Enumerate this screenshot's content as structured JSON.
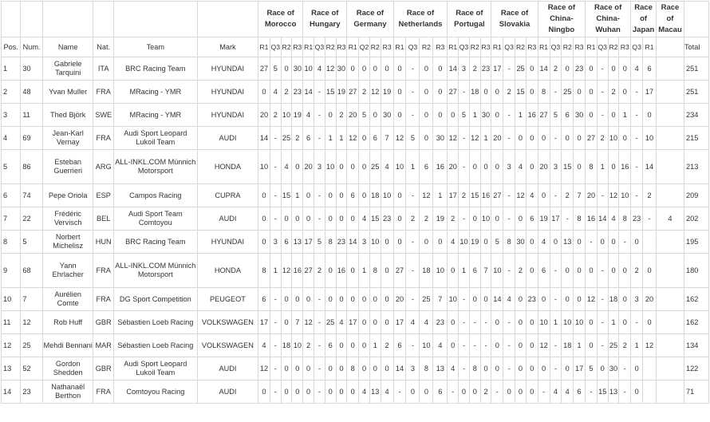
{
  "header": {
    "races": [
      {
        "label": "Race of Morocco",
        "rounds": [
          "R1",
          "Q3",
          "R2",
          "R3"
        ]
      },
      {
        "label": "Race of Hungary",
        "rounds": [
          "R1",
          "Q3",
          "R2",
          "R3"
        ]
      },
      {
        "label": "Race of Germany",
        "rounds": [
          "R1",
          "Q2",
          "R2",
          "R3"
        ]
      },
      {
        "label": "Race of Netherlands",
        "rounds": [
          "R1",
          "Q3",
          "R2",
          "R3"
        ]
      },
      {
        "label": "Race of Portugal",
        "rounds": [
          "R1",
          "Q3",
          "R2",
          "R3"
        ]
      },
      {
        "label": "Race of Slovakia",
        "rounds": [
          "R1",
          "Q3",
          "R2",
          "R3"
        ]
      },
      {
        "label": "Race of China-Ningbo",
        "rounds": [
          "R1",
          "Q3",
          "R2",
          "R3"
        ]
      },
      {
        "label": "Race of China-Wuhan",
        "rounds": [
          "R1",
          "Q3",
          "R2",
          "R3"
        ]
      },
      {
        "label": "Race of Japan",
        "rounds": [
          "Q3",
          "R1"
        ]
      },
      {
        "label": "Race of Macau",
        "rounds": [
          ""
        ]
      }
    ],
    "pos": "Pos.",
    "num": "Num.",
    "name": "Name",
    "nat": "Nat.",
    "team": "Team",
    "mark": "Mark",
    "total": "Total"
  },
  "rows": [
    {
      "pos": "1",
      "num": "30",
      "name": "Gabriele Tarquini",
      "nat": "ITA",
      "team": "BRC Racing Team",
      "mark": "HYUNDAI",
      "total": "251",
      "tall": false,
      "r": [
        "27",
        "5",
        "0",
        "30",
        "10",
        "4",
        "12",
        "30",
        "0",
        "0",
        "0",
        "0",
        "0",
        "-",
        "0",
        "0",
        "14",
        "3",
        "2",
        "23",
        "17",
        "-",
        "25",
        "0",
        "14",
        "2",
        "0",
        "23",
        "0",
        "-",
        "0",
        "0",
        "4",
        "6",
        ""
      ]
    },
    {
      "pos": "2",
      "num": "48",
      "name": "Yvan Muller",
      "nat": "FRA",
      "team": "MRacing - YMR",
      "mark": "HYUNDAI",
      "total": "251",
      "tall": false,
      "r": [
        "0",
        "4",
        "2",
        "23",
        "14",
        "-",
        "15",
        "19",
        "27",
        "2",
        "12",
        "19",
        "0",
        "-",
        "0",
        "0",
        "27",
        "-",
        "18",
        "0",
        "0",
        "2",
        "15",
        "0",
        "8",
        "-",
        "25",
        "0",
        "0",
        "-",
        "2",
        "0",
        "-",
        "17",
        ""
      ]
    },
    {
      "pos": "3",
      "num": "11",
      "name": "Thed Björk",
      "nat": "SWE",
      "team": "MRacing - YMR",
      "mark": "HYUNDAI",
      "total": "234",
      "tall": false,
      "r": [
        "20",
        "2",
        "10",
        "19",
        "4",
        "-",
        "0",
        "2",
        "20",
        "5",
        "0",
        "30",
        "0",
        "-",
        "0",
        "0",
        "0",
        "5",
        "1",
        "30",
        "0",
        "-",
        "1",
        "16",
        "27",
        "5",
        "6",
        "30",
        "0",
        "-",
        "0",
        "1",
        "-",
        "0",
        ""
      ]
    },
    {
      "pos": "4",
      "num": "69",
      "name": "Jean-Karl Vernay",
      "nat": "FRA",
      "team": "Audi Sport Leopard Lukoil Team",
      "mark": "AUDI",
      "total": "215",
      "tall": false,
      "r": [
        "14",
        "-",
        "25",
        "2",
        "6",
        "-",
        "1",
        "1",
        "12",
        "0",
        "6",
        "7",
        "12",
        "5",
        "0",
        "30",
        "12",
        "-",
        "12",
        "1",
        "20",
        "-",
        "0",
        "0",
        "0",
        "-",
        "0",
        "0",
        "27",
        "2",
        "10",
        "0",
        "-",
        "10",
        ""
      ]
    },
    {
      "pos": "5",
      "num": "86",
      "name": "Esteban Guerrieri",
      "nat": "ARG",
      "team": "ALL-INKL.COM Münnich Motorsport",
      "mark": "HONDA",
      "total": "213",
      "tall": true,
      "r": [
        "10",
        "-",
        "4",
        "0",
        "20",
        "3",
        "10",
        "0",
        "0",
        "0",
        "25",
        "4",
        "10",
        "1",
        "6",
        "16",
        "20",
        "-",
        "0",
        "0",
        "0",
        "3",
        "4",
        "0",
        "20",
        "3",
        "15",
        "0",
        "8",
        "1",
        "0",
        "16",
        "-",
        "14",
        ""
      ]
    },
    {
      "pos": "6",
      "num": "74",
      "name": "Pepe Oriola",
      "nat": "ESP",
      "team": "Campos Racing",
      "mark": "CUPRA",
      "total": "209",
      "tall": false,
      "r": [
        "0",
        "-",
        "15",
        "1",
        "0",
        "-",
        "0",
        "0",
        "6",
        "0",
        "18",
        "10",
        "0",
        "-",
        "12",
        "1",
        "17",
        "2",
        "15",
        "16",
        "27",
        "-",
        "12",
        "4",
        "0",
        "-",
        "2",
        "7",
        "20",
        "-",
        "12",
        "10",
        "-",
        "2",
        ""
      ]
    },
    {
      "pos": "7",
      "num": "22",
      "name": "Frédéric Vervisch",
      "nat": "BEL",
      "team": "Audi Sport Team Comtoyou",
      "mark": "AUDI",
      "total": "202",
      "tall": false,
      "r": [
        "0",
        "-",
        "0",
        "0",
        "0",
        "-",
        "0",
        "0",
        "0",
        "4",
        "15",
        "23",
        "0",
        "2",
        "2",
        "19",
        "2",
        "-",
        "0",
        "10",
        "0",
        "-",
        "0",
        "6",
        "19",
        "17",
        "-",
        "8",
        "16",
        "14",
        "4",
        "8",
        "23",
        "-",
        "4"
      ]
    },
    {
      "pos": "8",
      "num": "5",
      "name": "Norbert Michelisz",
      "nat": "HUN",
      "team": "BRC Racing Team",
      "mark": "HYUNDAI",
      "total": "195",
      "tall": false,
      "r": [
        "0",
        "3",
        "6",
        "13",
        "17",
        "5",
        "8",
        "23",
        "14",
        "3",
        "10",
        "0",
        "0",
        "-",
        "0",
        "0",
        "4",
        "10",
        "19",
        "0",
        "5",
        "8",
        "30",
        "0",
        "4",
        "0",
        "13",
        "0",
        "-",
        "0",
        "0",
        "-",
        "0",
        ""
      ]
    },
    {
      "pos": "9",
      "num": "68",
      "name": "Yann Ehrlacher",
      "nat": "FRA",
      "team": "ALL-INKL.COM Münnich Motorsport",
      "mark": "HONDA",
      "total": "180",
      "tall": true,
      "r": [
        "8",
        "1",
        "12",
        "16",
        "27",
        "2",
        "0",
        "16",
        "0",
        "1",
        "8",
        "0",
        "27",
        "-",
        "18",
        "10",
        "0",
        "1",
        "6",
        "7",
        "10",
        "-",
        "2",
        "0",
        "6",
        "-",
        "0",
        "0",
        "0",
        "-",
        "0",
        "0",
        "2",
        "0",
        ""
      ]
    },
    {
      "pos": "10",
      "num": "7",
      "name": "Aurélien Comte",
      "nat": "FRA",
      "team": "DG Sport Competition",
      "mark": "PEUGEOT",
      "total": "162",
      "tall": false,
      "r": [
        "6",
        "-",
        "0",
        "0",
        "0",
        "-",
        "0",
        "0",
        "0",
        "0",
        "0",
        "0",
        "20",
        "-",
        "25",
        "7",
        "10",
        "-",
        "0",
        "0",
        "14",
        "4",
        "0",
        "23",
        "0",
        "-",
        "0",
        "0",
        "12",
        "-",
        "18",
        "0",
        "3",
        "20",
        ""
      ]
    },
    {
      "pos": "11",
      "num": "12",
      "name": "Rob Huff",
      "nat": "GBR",
      "team": "Sébastien Loeb Racing",
      "mark": "VOLKSWAGEN",
      "total": "162",
      "tall": false,
      "r": [
        "17",
        "-",
        "0",
        "7",
        "12",
        "-",
        "25",
        "4",
        "17",
        "0",
        "0",
        "0",
        "17",
        "4",
        "4",
        "23",
        "0",
        "-",
        "-",
        "-",
        "0",
        "-",
        "0",
        "0",
        "10",
        "1",
        "10",
        "10",
        "0",
        "-",
        "1",
        "0",
        "-",
        "0",
        ""
      ]
    },
    {
      "pos": "12",
      "num": "25",
      "name": "Mehdi Bennani",
      "nat": "MAR",
      "team": "Sébastien Loeb Racing",
      "mark": "VOLKSWAGEN",
      "total": "134",
      "tall": false,
      "r": [
        "4",
        "-",
        "18",
        "10",
        "2",
        "-",
        "6",
        "0",
        "0",
        "0",
        "1",
        "2",
        "6",
        "-",
        "10",
        "4",
        "0",
        "-",
        "-",
        "-",
        "0",
        "-",
        "0",
        "0",
        "12",
        "-",
        "18",
        "1",
        "0",
        "-",
        "25",
        "2",
        "1",
        "12",
        ""
      ]
    },
    {
      "pos": "13",
      "num": "52",
      "name": "Gordon Shedden",
      "nat": "GBR",
      "team": "Audi Sport Leopard Lukoil Team",
      "mark": "AUDI",
      "total": "122",
      "tall": false,
      "r": [
        "12",
        "-",
        "0",
        "0",
        "0",
        "-",
        "0",
        "0",
        "8",
        "0",
        "0",
        "0",
        "14",
        "3",
        "8",
        "13",
        "4",
        "-",
        "8",
        "0",
        "0",
        "-",
        "0",
        "0",
        "0",
        "-",
        "0",
        "17",
        "5",
        "0",
        "30",
        "-",
        "0",
        "",
        ""
      ]
    },
    {
      "pos": "14",
      "num": "23",
      "name": "Nathanaël Berthon",
      "nat": "FRA",
      "team": "Comtoyou Racing",
      "mark": "AUDI",
      "total": "71",
      "tall": false,
      "r": [
        "0",
        "-",
        "0",
        "0",
        "0",
        "-",
        "0",
        "0",
        "0",
        "4",
        "13",
        "4",
        "-",
        "0",
        "0",
        "6",
        "-",
        "0",
        "0",
        "2",
        "-",
        "0",
        "0",
        "0",
        "-",
        "4",
        "4",
        "6",
        "-",
        "15",
        "13",
        "-",
        "0",
        "",
        ""
      ]
    }
  ]
}
